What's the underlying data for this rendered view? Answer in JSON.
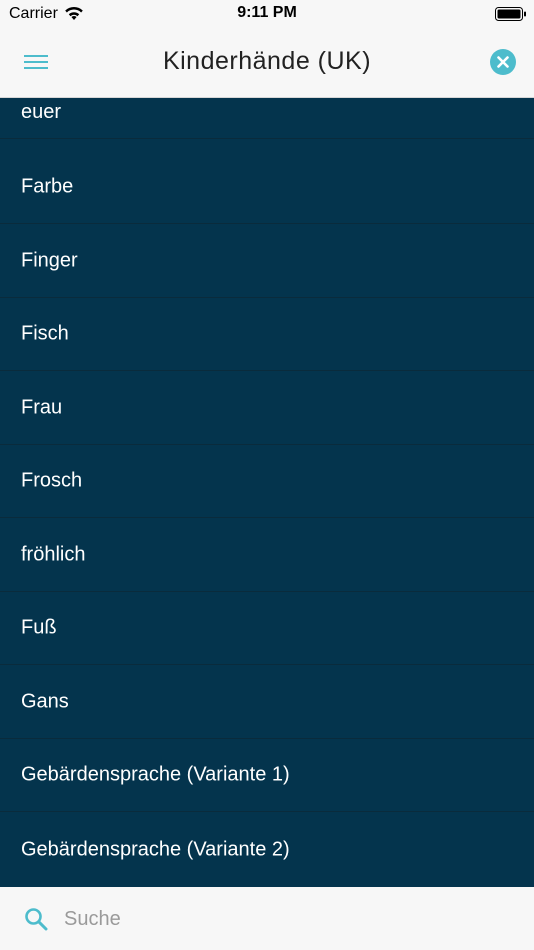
{
  "status_bar": {
    "carrier": "Carrier",
    "time": "9:11 PM",
    "wifi_icon": "wifi-icon",
    "battery_icon": "battery-icon"
  },
  "header": {
    "title": "Kinderhände (UK)",
    "menu_icon": "hamburger-menu-icon",
    "close_icon": "close-circle-icon",
    "accent_color": "#4dbccc"
  },
  "list": {
    "background_color": "#04344d",
    "items": [
      {
        "label": "euer"
      },
      {
        "label": "Farbe"
      },
      {
        "label": "Finger"
      },
      {
        "label": "Fisch"
      },
      {
        "label": "Frau"
      },
      {
        "label": "Frosch"
      },
      {
        "label": "fröhlich"
      },
      {
        "label": "Fuß"
      },
      {
        "label": "Gans"
      },
      {
        "label": "Gebärdensprache (Variante 1)"
      },
      {
        "label": "Gebärdensprache (Variante 2)"
      }
    ]
  },
  "search": {
    "icon": "search-icon",
    "placeholder": "Suche",
    "value": ""
  }
}
